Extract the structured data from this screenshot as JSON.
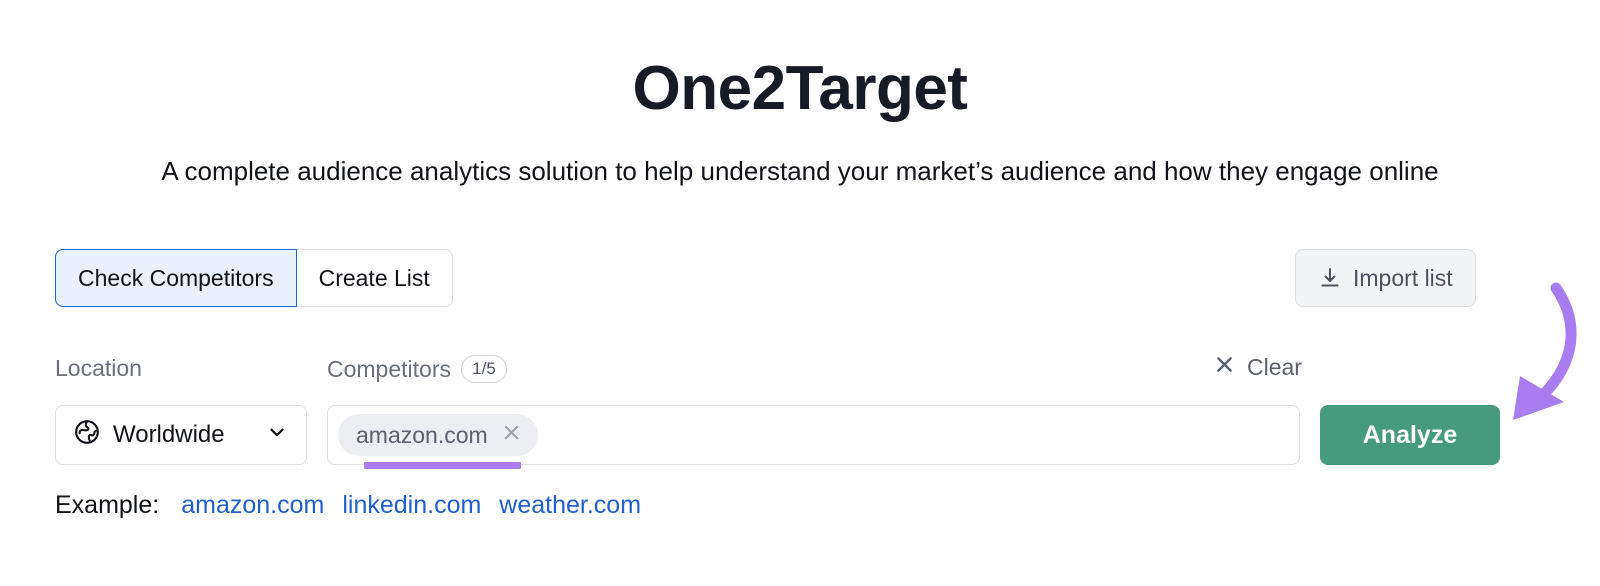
{
  "header": {
    "title": "One2Target",
    "subtitle": "A complete audience analytics solution to help understand your market’s audience and how they engage online"
  },
  "mode_toggle": {
    "options": [
      {
        "label": "Check Competitors",
        "active": true
      },
      {
        "label": "Create List",
        "active": false
      }
    ],
    "active_bg": "#e9f1fd",
    "active_border": "#1a67dd"
  },
  "import": {
    "label": "Import list",
    "icon": "download-icon"
  },
  "location": {
    "label": "Location",
    "value": "Worldwide",
    "icon": "globe-icon",
    "chevron": "chevron-down-icon"
  },
  "competitors": {
    "label": "Competitors",
    "count": "1/5",
    "placeholder": "",
    "chips": [
      {
        "label": "amazon.com",
        "remove_icon": "close-icon"
      }
    ],
    "clear": {
      "label": "Clear",
      "icon": "close-icon"
    }
  },
  "analyze": {
    "label": "Analyze",
    "color": "#469b7f"
  },
  "examples": {
    "label": "Example:",
    "links": [
      "amazon.com",
      "linkedin.com",
      "weather.com"
    ],
    "link_color": "#1f5fd0"
  },
  "annotations": {
    "arrow_color": "#a97cf0",
    "highlight_color": "#a97cf0"
  }
}
